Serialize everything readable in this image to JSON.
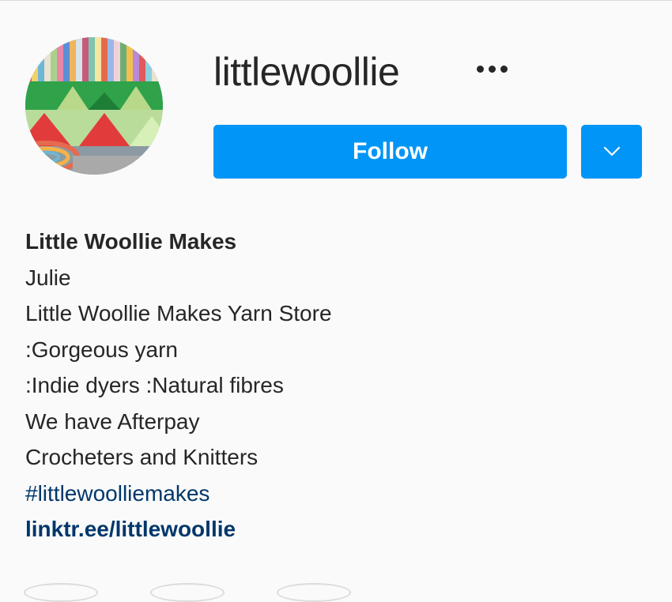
{
  "profile": {
    "username": "littlewoollie",
    "follow_label": "Follow"
  },
  "bio": {
    "name": "Little Woollie Makes",
    "lines": [
      "Julie",
      "Little Woollie Makes Yarn Store",
      ":Gorgeous yarn",
      ":Indie dyers :Natural fibres",
      "We have Afterpay",
      "Crocheters and Knitters"
    ],
    "hashtag": "#littlewoolliemakes",
    "link": "linktr.ee/littlewoollie"
  },
  "icons": {
    "more": "more-horizontal-icon",
    "dropdown": "chevron-down-icon"
  },
  "colors": {
    "background": "#fafafa",
    "primary_button": "#0095f6",
    "text": "#262626",
    "link": "#00376b"
  }
}
